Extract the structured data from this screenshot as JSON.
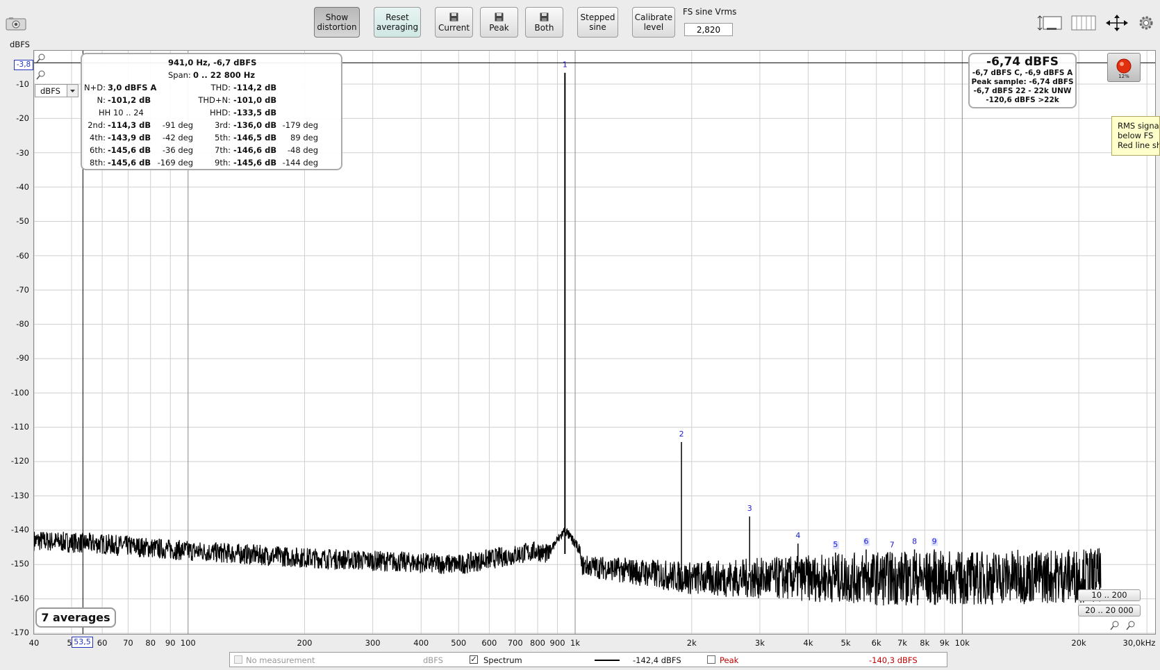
{
  "toolbar": {
    "show_distortion": "Show\ndistortion",
    "show_distortion_l1": "Show",
    "show_distortion_l2": "distortion",
    "reset_l1": "Reset",
    "reset_l2": "averaging",
    "current": "Current",
    "peak": "Peak",
    "both": "Both",
    "stepped_l1": "Stepped",
    "stepped_l2": "sine",
    "calibrate_l1": "Calibrate",
    "calibrate_l2": "level",
    "fs_label": "FS sine Vrms",
    "fs_value": "2,820"
  },
  "axes": {
    "unit_label": "dBFS",
    "cursor_y": "-3,8",
    "cursor_x": "53,5",
    "unit_select": "dBFS",
    "y_ticks": [
      "-10",
      "-20",
      "-30",
      "-40",
      "-50",
      "-60",
      "-70",
      "-80",
      "-90",
      "-100",
      "-110",
      "-120",
      "-130",
      "-140",
      "-150",
      "-160",
      "-170"
    ],
    "x_ticks": [
      "40",
      "5",
      "60",
      "70",
      "80",
      "90",
      "100",
      "200",
      "300",
      "400",
      "500",
      "600",
      "700",
      "800",
      "900",
      "1k",
      "2k",
      "3k",
      "4k",
      "5k",
      "6k",
      "7k",
      "8k",
      "9k",
      "10k",
      "20k",
      "30,0kHz"
    ]
  },
  "distortion_panel": {
    "header": "941,0 Hz, -6,7 dBFS",
    "span_label": "Span:",
    "span_value": "0 .. 22 800 Hz",
    "nd_label": "N+D:",
    "nd_value": "3,0 dBFS A",
    "thd_label": "THD:",
    "thd_value": "-114,2 dB",
    "n_label": "N:",
    "n_value": "-101,2 dB",
    "thdn_label": "THD+N:",
    "thdn_value": "-101,0 dB",
    "hh_label": "HH 10 .. 24",
    "hhd_label": "HHD:",
    "hhd_value": "-133,5 dB",
    "harmonics": [
      {
        "l1": "2nd:",
        "v1": "-114,3 dB",
        "p1": "-91 deg",
        "l2": "3rd:",
        "v2": "-136,0 dB",
        "p2": "-179 deg"
      },
      {
        "l1": "4th:",
        "v1": "-143,9 dB",
        "p1": "-42 deg",
        "l2": "5th:",
        "v2": "-146,5 dB",
        "p2": "89 deg"
      },
      {
        "l1": "6th:",
        "v1": "-145,6 dB",
        "p1": "-36 deg",
        "l2": "7th:",
        "v2": "-146,6 dB",
        "p2": "-48 deg"
      },
      {
        "l1": "8th:",
        "v1": "-145,6 dB",
        "p1": "-169 deg",
        "l2": "9th:",
        "v2": "-145,6 dB",
        "p2": "-144 deg"
      }
    ]
  },
  "level_panel": {
    "main": "-6,74 dBFS",
    "line1": "-6,7 dBFS C, -6,9 dBFS A",
    "line2": "Peak sample: -6,74 dBFS",
    "line3": "-6,7 dBFS 22 - 22k UNW",
    "line4": "-120,6 dBFS >22k",
    "meter_pct": "12%"
  },
  "tooltip": {
    "line1": "RMS signal",
    "line2": "below FS",
    "line3": "Red line sh"
  },
  "averages": "7 averages",
  "range_buttons": [
    "10 .. 200",
    "20 .. 20 000"
  ],
  "harmonic_markers": [
    "1",
    "2",
    "3",
    "4",
    "5",
    "6",
    "7",
    "8",
    "9"
  ],
  "legend": {
    "no_measurement": "No measurement",
    "no_meas_unit": "dBFS",
    "spectrum": "Spectrum",
    "spectrum_value": "-142,4 dBFS",
    "peak": "Peak",
    "peak_value": "-140,3 dBFS"
  },
  "colors": {
    "trace": "#000000",
    "marker_blue": "#1a1acc",
    "peak_red": "#c00000",
    "tooltip_bg": "#ffffcc",
    "record_red": "#e03010"
  },
  "chart_data": {
    "type": "line",
    "x_scale": "log",
    "xlim": [
      40,
      30000
    ],
    "ylim": [
      -170,
      -3.8
    ],
    "ylabel": "dBFS",
    "series": [
      {
        "name": "Spectrum",
        "peaks": [
          {
            "label": "1",
            "freq": 941,
            "level": -6.7
          },
          {
            "label": "2",
            "freq": 1882,
            "level": -114.3
          },
          {
            "label": "3",
            "freq": 2823,
            "level": -136.0
          },
          {
            "label": "4",
            "freq": 3764,
            "level": -143.9
          },
          {
            "label": "5",
            "freq": 4705,
            "level": -146.5
          },
          {
            "label": "6",
            "freq": 5646,
            "level": -145.6
          },
          {
            "label": "7",
            "freq": 6587,
            "level": -146.6
          },
          {
            "label": "8",
            "freq": 7528,
            "level": -145.6
          },
          {
            "label": "9",
            "freq": 8469,
            "level": -145.6
          }
        ],
        "noise_floor": [
          [
            40,
            -143
          ],
          [
            60,
            -144
          ],
          [
            100,
            -146
          ],
          [
            200,
            -148
          ],
          [
            500,
            -150
          ],
          [
            800,
            -146
          ],
          [
            1000,
            -150
          ],
          [
            2000,
            -154
          ],
          [
            5000,
            -154
          ],
          [
            10000,
            -154
          ],
          [
            22800,
            -153
          ]
        ]
      }
    ]
  }
}
